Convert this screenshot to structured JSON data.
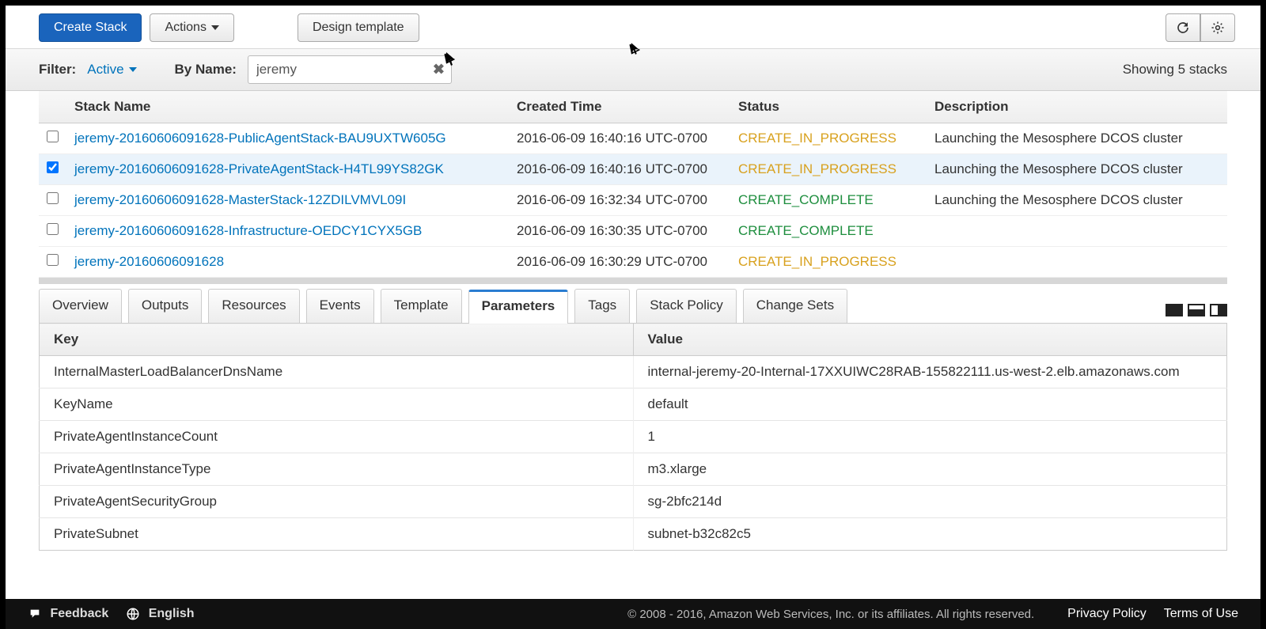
{
  "toolbar": {
    "create_label": "Create Stack",
    "actions_label": "Actions",
    "design_label": "Design template"
  },
  "filter": {
    "label": "Filter:",
    "status": "Active",
    "byname_label": "By Name:",
    "search_value": "jeremy",
    "showing": "Showing 5 stacks"
  },
  "stack_headers": {
    "name": "Stack Name",
    "created": "Created Time",
    "status": "Status",
    "description": "Description"
  },
  "stacks": [
    {
      "checked": false,
      "name": "jeremy-20160606091628-PublicAgentStack-BAU9UXTW605G",
      "created": "2016-06-09 16:40:16 UTC-0700",
      "status": "CREATE_IN_PROGRESS",
      "status_class": "progress",
      "desc": "Launching the Mesosphere DCOS cluster"
    },
    {
      "checked": true,
      "name": "jeremy-20160606091628-PrivateAgentStack-H4TL99YS82GK",
      "created": "2016-06-09 16:40:16 UTC-0700",
      "status": "CREATE_IN_PROGRESS",
      "status_class": "progress",
      "desc": "Launching the Mesosphere DCOS cluster"
    },
    {
      "checked": false,
      "name": "jeremy-20160606091628-MasterStack-12ZDILVMVL09I",
      "created": "2016-06-09 16:32:34 UTC-0700",
      "status": "CREATE_COMPLETE",
      "status_class": "complete",
      "desc": "Launching the Mesosphere DCOS cluster"
    },
    {
      "checked": false,
      "name": "jeremy-20160606091628-Infrastructure-OEDCY1CYX5GB",
      "created": "2016-06-09 16:30:35 UTC-0700",
      "status": "CREATE_COMPLETE",
      "status_class": "complete",
      "desc": ""
    },
    {
      "checked": false,
      "name": "jeremy-20160606091628",
      "created": "2016-06-09 16:30:29 UTC-0700",
      "status": "CREATE_IN_PROGRESS",
      "status_class": "progress",
      "desc": ""
    }
  ],
  "tabs": {
    "overview": "Overview",
    "outputs": "Outputs",
    "resources": "Resources",
    "events": "Events",
    "template": "Template",
    "parameters": "Parameters",
    "tags": "Tags",
    "stack_policy": "Stack Policy",
    "change_sets": "Change Sets",
    "active": "parameters"
  },
  "params_headers": {
    "key": "Key",
    "value": "Value"
  },
  "parameters": [
    {
      "key": "InternalMasterLoadBalancerDnsName",
      "value": "internal-jeremy-20-Internal-17XXUIWC28RAB-155822111.us-west-2.elb.amazonaws.com"
    },
    {
      "key": "KeyName",
      "value": "default"
    },
    {
      "key": "PrivateAgentInstanceCount",
      "value": "1"
    },
    {
      "key": "PrivateAgentInstanceType",
      "value": "m3.xlarge"
    },
    {
      "key": "PrivateAgentSecurityGroup",
      "value": "sg-2bfc214d"
    },
    {
      "key": "PrivateSubnet",
      "value": "subnet-b32c82c5"
    }
  ],
  "footer": {
    "feedback": "Feedback",
    "language": "English",
    "copyright": "© 2008 - 2016, Amazon Web Services, Inc. or its affiliates. All rights reserved.",
    "privacy": "Privacy Policy",
    "terms": "Terms of Use"
  }
}
